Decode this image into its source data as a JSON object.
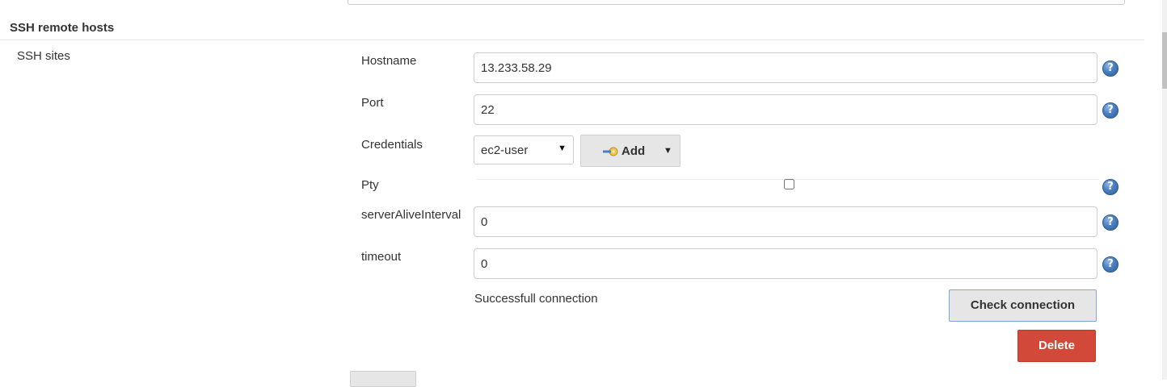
{
  "section": {
    "title": "SSH remote hosts",
    "row_label": "SSH sites"
  },
  "fields": {
    "hostname": {
      "label": "Hostname",
      "value": "13.233.58.29"
    },
    "port": {
      "label": "Port",
      "value": "22"
    },
    "credentials": {
      "label": "Credentials",
      "selected": "ec2-user"
    },
    "pty": {
      "label": "Pty",
      "checked": false
    },
    "server_alive_interval": {
      "label": "serverAliveInterval",
      "value": "0"
    },
    "timeout": {
      "label": "timeout",
      "value": "0"
    }
  },
  "buttons": {
    "add_label": "Add",
    "check_connection_label": "Check connection",
    "delete_label": "Delete"
  },
  "status": {
    "text": "Successfull connection"
  },
  "help_glyph": "?",
  "icons": {
    "help": "help-icon",
    "key": "key-icon",
    "dropdown": "caret-down-icon"
  },
  "colors": {
    "delete_button": "#d24939",
    "help_icon": "#4a7fbf",
    "check_button_border": "#7ea6d9"
  }
}
